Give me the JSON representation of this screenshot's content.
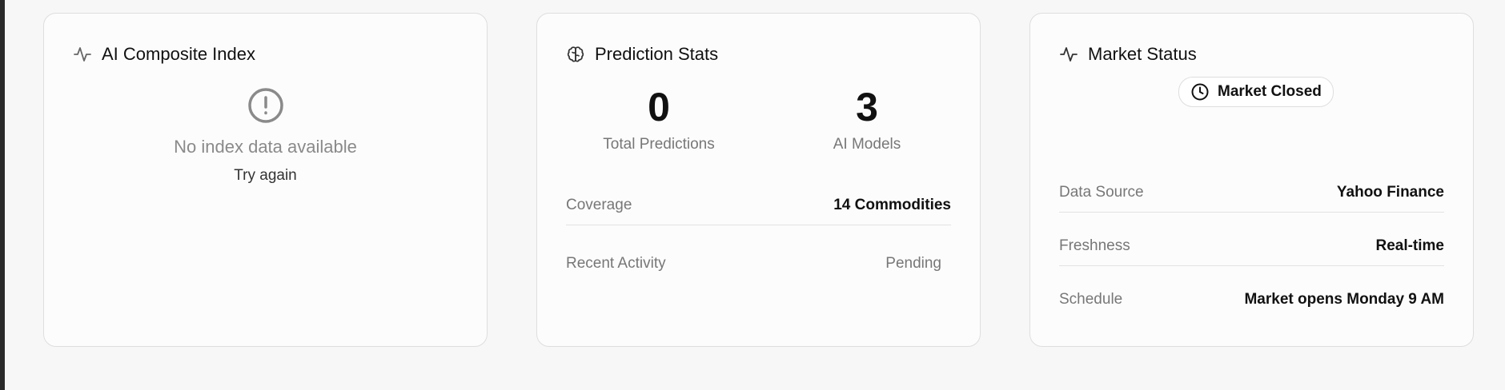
{
  "ai_card": {
    "title": "AI Composite Index",
    "icon": "activity-icon",
    "empty_icon": "alert-circle-icon",
    "empty_message": "No index data available",
    "retry_label": "Try again"
  },
  "prediction_card": {
    "title": "Prediction Stats",
    "icon": "brain-icon",
    "stats": [
      {
        "value": "0",
        "label": "Total Predictions"
      },
      {
        "value": "3",
        "label": "AI Models"
      }
    ],
    "rows": [
      {
        "label": "Coverage",
        "value": "14 Commodities"
      },
      {
        "label": "Recent Activity",
        "value": "Pending"
      }
    ]
  },
  "market_card": {
    "title": "Market Status",
    "icon": "activity-icon",
    "badge": {
      "label": "Market Closed",
      "icon": "clock-icon"
    },
    "rows": [
      {
        "label": "Data Source",
        "value": "Yahoo Finance"
      },
      {
        "label": "Freshness",
        "value": "Real-time"
      },
      {
        "label": "Schedule",
        "value": "Market opens Monday 9 AM"
      }
    ]
  },
  "colors": {
    "background": "#f7f7f7",
    "card_background": "#fcfcfc",
    "border": "#dedede",
    "muted_text": "#777777",
    "primary_text": "#111111"
  }
}
